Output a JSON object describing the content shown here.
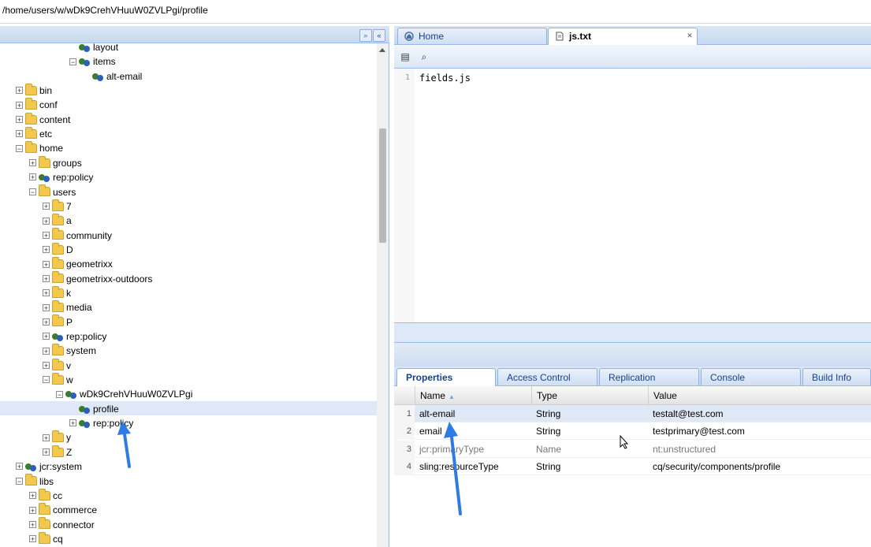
{
  "path_bar": {
    "value": "/home/users/w/wDk9CrehVHuuW0ZVLPgi/profile"
  },
  "tree_header_buttons": [
    "binoculars-icon",
    "collapse-left-icon"
  ],
  "tree": [
    {
      "label": "layout",
      "depth": 5,
      "icon": "node",
      "toggle": ""
    },
    {
      "label": "items",
      "depth": 5,
      "icon": "node",
      "toggle": "-"
    },
    {
      "label": "alt-email",
      "depth": 6,
      "icon": "node",
      "toggle": ""
    },
    {
      "label": "bin",
      "depth": 1,
      "icon": "folder",
      "toggle": "+"
    },
    {
      "label": "conf",
      "depth": 1,
      "icon": "folder",
      "toggle": "+"
    },
    {
      "label": "content",
      "depth": 1,
      "icon": "folder",
      "toggle": "+"
    },
    {
      "label": "etc",
      "depth": 1,
      "icon": "folder",
      "toggle": "+"
    },
    {
      "label": "home",
      "depth": 1,
      "icon": "folder",
      "toggle": "-"
    },
    {
      "label": "groups",
      "depth": 2,
      "icon": "folder",
      "toggle": "+"
    },
    {
      "label": "rep:policy",
      "depth": 2,
      "icon": "node",
      "toggle": "+"
    },
    {
      "label": "users",
      "depth": 2,
      "icon": "folder",
      "toggle": "-"
    },
    {
      "label": "7",
      "depth": 3,
      "icon": "folder",
      "toggle": "+"
    },
    {
      "label": "a",
      "depth": 3,
      "icon": "folder",
      "toggle": "+"
    },
    {
      "label": "community",
      "depth": 3,
      "icon": "folder",
      "toggle": "+"
    },
    {
      "label": "D",
      "depth": 3,
      "icon": "folder",
      "toggle": "+"
    },
    {
      "label": "geometrixx",
      "depth": 3,
      "icon": "folder",
      "toggle": "+"
    },
    {
      "label": "geometrixx-outdoors",
      "depth": 3,
      "icon": "folder",
      "toggle": "+"
    },
    {
      "label": "k",
      "depth": 3,
      "icon": "folder",
      "toggle": "+"
    },
    {
      "label": "media",
      "depth": 3,
      "icon": "folder",
      "toggle": "+"
    },
    {
      "label": "P",
      "depth": 3,
      "icon": "folder",
      "toggle": "+"
    },
    {
      "label": "rep:policy",
      "depth": 3,
      "icon": "node",
      "toggle": "+"
    },
    {
      "label": "system",
      "depth": 3,
      "icon": "folder",
      "toggle": "+"
    },
    {
      "label": "v",
      "depth": 3,
      "icon": "folder",
      "toggle": "+"
    },
    {
      "label": "w",
      "depth": 3,
      "icon": "folder",
      "toggle": "-"
    },
    {
      "label": "wDk9CrehVHuuW0ZVLPgi",
      "depth": 4,
      "icon": "node",
      "toggle": "-"
    },
    {
      "label": "profile",
      "depth": 5,
      "icon": "node",
      "toggle": "",
      "selected": true
    },
    {
      "label": "rep:policy",
      "depth": 5,
      "icon": "node",
      "toggle": "+"
    },
    {
      "label": "y",
      "depth": 3,
      "icon": "folder",
      "toggle": "+"
    },
    {
      "label": "Z",
      "depth": 3,
      "icon": "folder",
      "toggle": "+"
    },
    {
      "label": "jcr:system",
      "depth": 1,
      "icon": "node",
      "toggle": "+"
    },
    {
      "label": "libs",
      "depth": 1,
      "icon": "folder",
      "toggle": "-"
    },
    {
      "label": "cc",
      "depth": 2,
      "icon": "folder",
      "toggle": "+"
    },
    {
      "label": "commerce",
      "depth": 2,
      "icon": "folder",
      "toggle": "+"
    },
    {
      "label": "connector",
      "depth": 2,
      "icon": "folder",
      "toggle": "+"
    },
    {
      "label": "cq",
      "depth": 2,
      "icon": "folder",
      "toggle": "+"
    }
  ],
  "editor_tabs": [
    {
      "label": "Home",
      "icon": "home-icon"
    },
    {
      "label": "js.txt",
      "icon": "file-icon",
      "active": true,
      "closable": true
    }
  ],
  "editor": {
    "line_number": "1",
    "code": "fields.js"
  },
  "property_tabs": [
    "Properties",
    "Access Control",
    "Replication",
    "Console",
    "Build Info"
  ],
  "grid": {
    "columns": [
      "Name",
      "Type",
      "Value"
    ],
    "rows": [
      {
        "n": "1",
        "name": "alt-email",
        "type": "String",
        "value": "testalt@test.com",
        "selected": true
      },
      {
        "n": "2",
        "name": "email",
        "type": "String",
        "value": "testprimary@test.com"
      },
      {
        "n": "3",
        "name": "jcr:primaryType",
        "type": "Name",
        "value": "nt:unstructured",
        "dim": true
      },
      {
        "n": "4",
        "name": "sling:resourceType",
        "type": "String",
        "value": "cq/security/components/profile"
      }
    ]
  },
  "colors": {
    "accent": "#15428b",
    "selection": "#dfe8f6",
    "annotation_arrow": "#2f7be6"
  }
}
